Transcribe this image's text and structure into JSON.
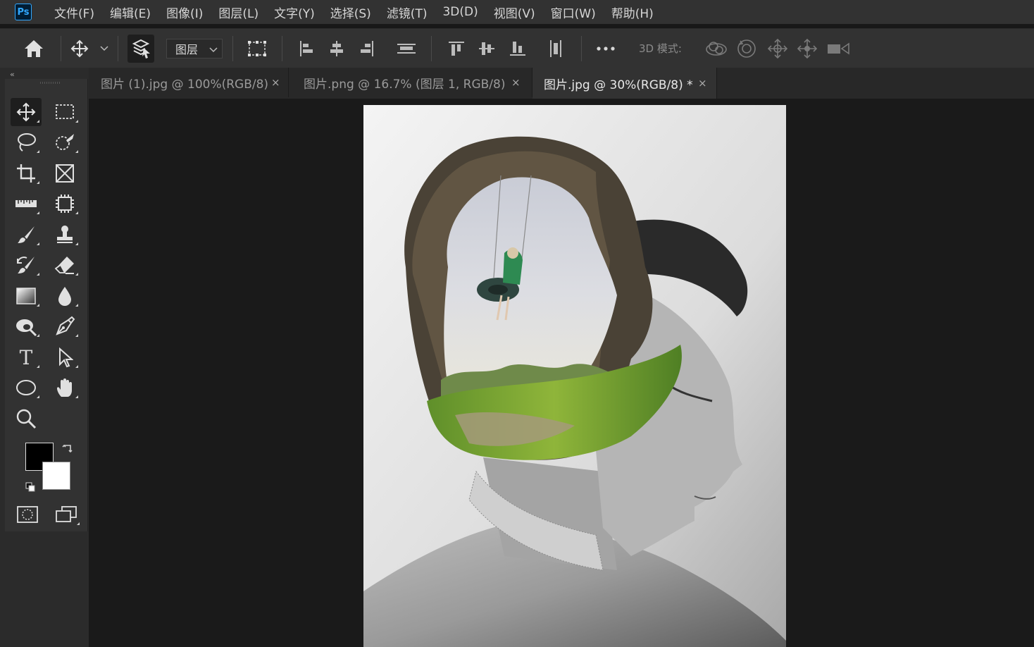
{
  "app": {
    "logo": "Ps"
  },
  "menu": [
    "文件(F)",
    "编辑(E)",
    "图像(I)",
    "图层(L)",
    "文字(Y)",
    "选择(S)",
    "滤镜(T)",
    "3D(D)",
    "视图(V)",
    "窗口(W)",
    "帮助(H)"
  ],
  "options": {
    "auto_select_target": "图层",
    "mode_3d_label": "3D 模式:",
    "icons": [
      "home-icon",
      "move-icon",
      "auto-select-layers-icon",
      "transform-controls-icon",
      "align-left-icon",
      "align-horizontal-center-icon",
      "align-right-icon",
      "distribute-vertical-icon",
      "align-top-icon",
      "align-vertical-center-icon",
      "align-bottom-icon",
      "distribute-horizontal-icon",
      "more-icon",
      "orbit-3d-icon",
      "roll-3d-icon",
      "drag-3d-icon",
      "slide-3d-icon",
      "scale-3d-video-icon"
    ]
  },
  "panel": {
    "collapse_glyph": "‹‹"
  },
  "tools": {
    "type_glyph": "T",
    "list": [
      "move",
      "rectangular-marquee",
      "lasso",
      "quick-selection",
      "crop",
      "frame",
      "ruler",
      "content-aware-patch",
      "brush",
      "clone-stamp",
      "history-brush",
      "eraser",
      "gradient",
      "blur",
      "dodge",
      "pen",
      "type",
      "path-selection",
      "ellipse",
      "hand",
      "zoom",
      "quick-mask",
      "screen-mode"
    ],
    "foreground_color": "#000000",
    "background_color": "#ffffff"
  },
  "tabs": [
    {
      "label": "图片 (1).jpg @ 100%(RGB/8)",
      "close": "×",
      "active": false
    },
    {
      "label": "图片.png @ 16.7% (图层 1, RGB/8)",
      "close": "×",
      "active": false
    },
    {
      "label": "图片.jpg @ 30%(RGB/8) *",
      "close": "×",
      "active": true
    }
  ],
  "colors": {
    "app_bg": "#323232",
    "canvas_bg": "#1a1a1a",
    "accent": "#31a8ff"
  }
}
